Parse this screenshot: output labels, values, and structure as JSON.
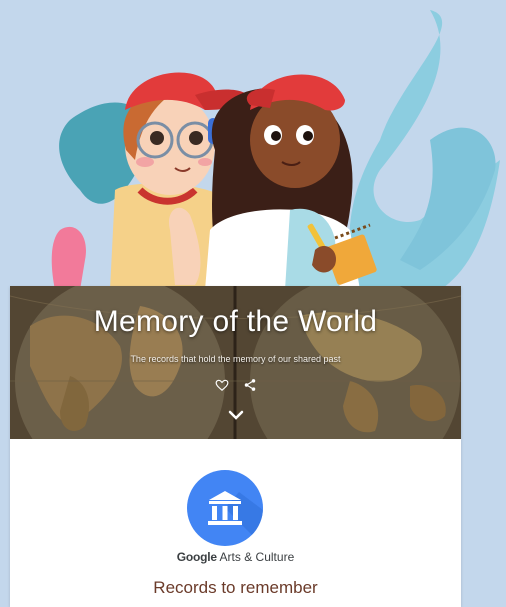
{
  "hero": {
    "title": "Memory of the World",
    "subtitle": "The records that hold the memory of our shared past",
    "actions": [
      {
        "name": "favorite",
        "icon": "heart-icon"
      },
      {
        "name": "share",
        "icon": "share-icon"
      }
    ],
    "scroll_icon": "chevron-down-icon"
  },
  "brand": {
    "google": "Google",
    "product": "Arts & Culture",
    "logo_icon": "museum-building-icon",
    "logo_color": "#4285f4"
  },
  "section": {
    "heading": "Records to remember"
  },
  "colors": {
    "background": "#c3d7ec",
    "swirl": "#8ccde0",
    "cap": "#e23b3b",
    "heading_brown": "#6b3b2a"
  }
}
